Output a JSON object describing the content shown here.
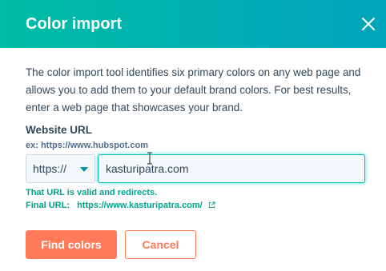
{
  "modal": {
    "title": "Color import",
    "close_icon": "close-icon"
  },
  "description": "The color import tool identifies six primary colors on any web page and allows you to add them to your default brand colors. For best results, enter a web page that showcases your brand.",
  "url_field": {
    "label": "Website URL",
    "help": "ex: https://www.hubspot.com",
    "protocol": "https://",
    "value": "kasturipatra.com"
  },
  "validation": {
    "message": "That URL is valid and redirects.",
    "final_url_label": "Final URL:",
    "final_url": "https://www.kasturipatra.com/",
    "external_icon": "external-link-icon"
  },
  "buttons": {
    "primary": "Find colors",
    "secondary": "Cancel"
  },
  "colors": {
    "header_gradient_start": "#00bda5",
    "header_gradient_end": "#00a4bd",
    "accent": "#ff7a59",
    "valid": "#00a38d",
    "text": "#33475b"
  }
}
